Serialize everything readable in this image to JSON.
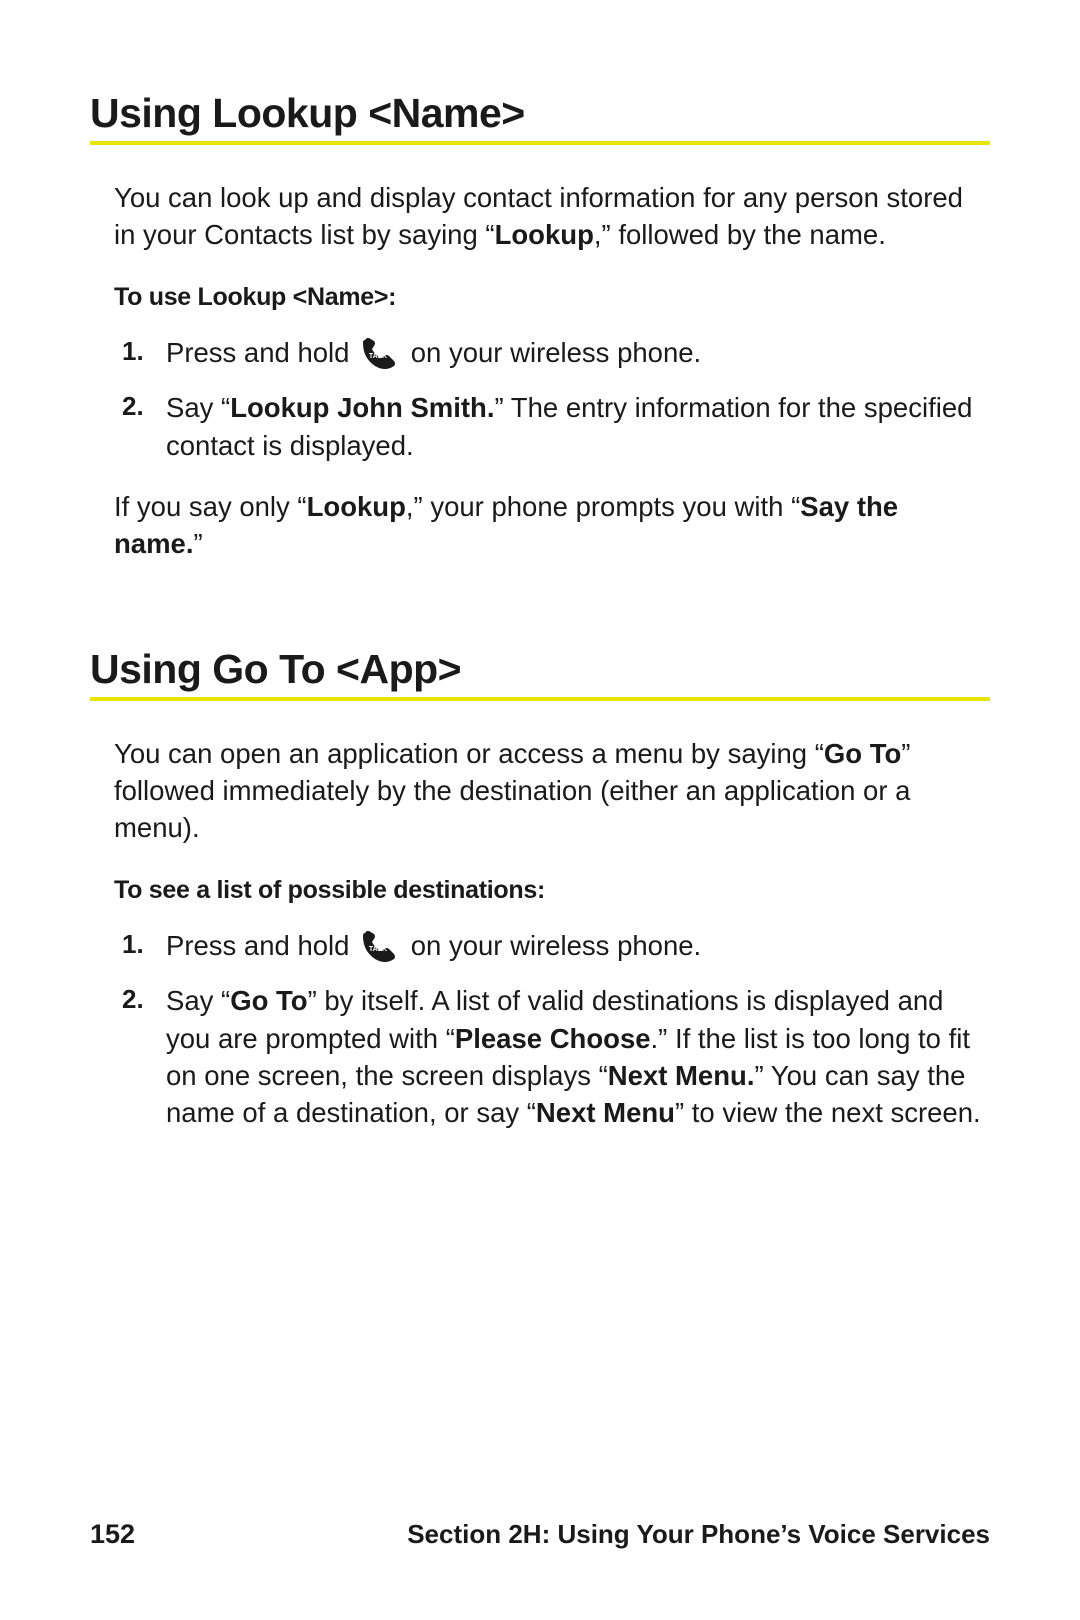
{
  "section1": {
    "heading": "Using Lookup <Name>",
    "intro_parts": {
      "p1": "You can look up and display contact information for any person stored in your Contacts list by saying “",
      "bold1": "Lookup",
      "p2": ",” followed by the name."
    },
    "subhead": "To use Lookup <Name>:",
    "step1": {
      "a": "Press and hold ",
      "b": " on your wireless phone."
    },
    "step2": {
      "a": "Say “",
      "bold": "Lookup John Smith.",
      "b": "” The entry information for the specified contact is displayed."
    },
    "followup": {
      "a": "If you say only “",
      "bold1": "Lookup",
      "b": ",” your phone prompts you with “",
      "bold2": "Say the name.",
      "c": "”"
    }
  },
  "section2": {
    "heading": "Using Go To <App>",
    "intro_parts": {
      "a": "You can open an application or access a menu by saying “",
      "bold": "Go To",
      "b": "” followed immediately by the destination (either an application or a menu)."
    },
    "subhead": "To see a list of possible destinations:",
    "step1": {
      "a": "Press and hold ",
      "b": " on your wireless phone."
    },
    "step2": {
      "a": "Say “",
      "bold1": "Go To",
      "b": "” by itself. A list of valid destinations is displayed and you are prompted with “",
      "bold2": "Please Choose",
      "c": ".” If the list is too long to fit on one screen, the screen displays “",
      "bold3": "Next Menu.",
      "d": "” You can say the name of a destination, or say “",
      "bold4": "Next Menu",
      "e": "” to view the next screen."
    }
  },
  "footer": {
    "page_number": "152",
    "section_label": "Section 2H: Using Your Phone’s Voice Services"
  },
  "icons": {
    "talk_label": "TALK"
  }
}
